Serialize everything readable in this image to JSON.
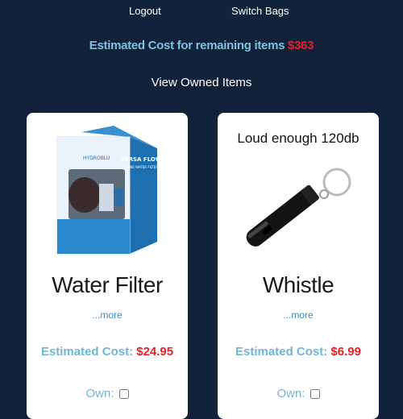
{
  "nav": {
    "logout": "Logout",
    "switch_bags": "Switch Bags"
  },
  "summary": {
    "label": "Estimated Cost for remaining items",
    "value": "$363"
  },
  "view_owned": "View Owned Items",
  "items": [
    {
      "title": "Water Filter",
      "more": "...more",
      "cost_label": "Estimated Cost:",
      "cost_value": "$24.95",
      "own_label": "Own:",
      "image_text": {
        "brand": "HYDROBLU",
        "product": "VERSA FLOW",
        "sub": "INLINE WATER FILTER"
      }
    },
    {
      "title": "Whistle",
      "more": "...more",
      "cost_label": "Estimated Cost:",
      "cost_value": "$6.99",
      "own_label": "Own:",
      "image_caption": "Loud enough 120db"
    }
  ],
  "colors": {
    "background": "#12223b",
    "accent": "#7ec3de",
    "price": "#e8202a"
  }
}
